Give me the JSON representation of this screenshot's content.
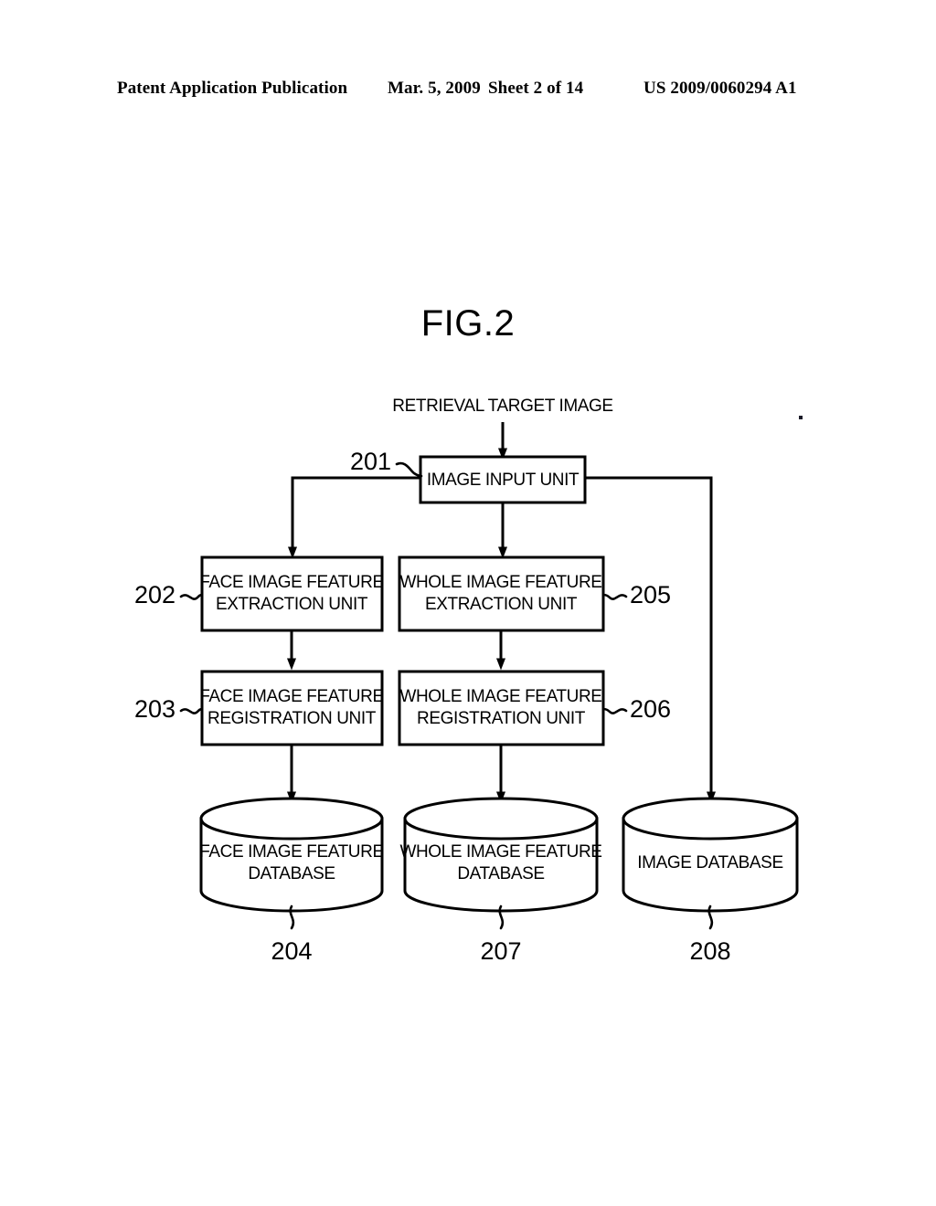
{
  "header": {
    "publication": "Patent Application Publication",
    "date": "Mar. 5, 2009",
    "sheet": "Sheet 2 of 14",
    "patent_number": "US 2009/0060294 A1"
  },
  "figure": {
    "title": "FIG.2",
    "input_label": "RETRIEVAL TARGET IMAGE",
    "boxes": [
      {
        "ref": "201",
        "line1": "IMAGE INPUT UNIT",
        "line2": ""
      },
      {
        "ref": "202",
        "line1": "FACE IMAGE FEATURE",
        "line2": "EXTRACTION UNIT"
      },
      {
        "ref": "205",
        "line1": "WHOLE IMAGE FEATURE",
        "line2": "EXTRACTION UNIT"
      },
      {
        "ref": "203",
        "line1": "FACE IMAGE FEATURE",
        "line2": "REGISTRATION UNIT"
      },
      {
        "ref": "206",
        "line1": "WHOLE IMAGE FEATURE",
        "line2": "REGISTRATION UNIT"
      }
    ],
    "databases": [
      {
        "ref": "204",
        "line1": "FACE IMAGE FEATURE",
        "line2": "DATABASE"
      },
      {
        "ref": "207",
        "line1": "WHOLE IMAGE FEATURE",
        "line2": "DATABASE"
      },
      {
        "ref": "208",
        "line1": "IMAGE DATABASE",
        "line2": ""
      }
    ]
  }
}
